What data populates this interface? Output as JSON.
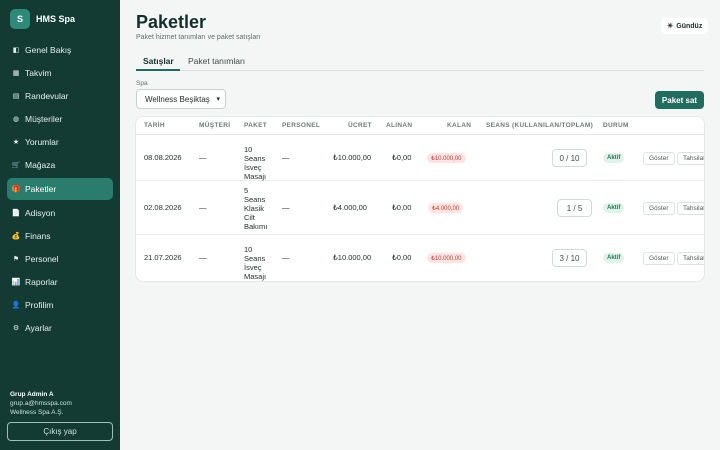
{
  "app": {
    "badge": "S",
    "name": "HMS Spa"
  },
  "nav": [
    {
      "label": "Genel Bakış",
      "icon": "dashboard-icon",
      "glyph": "◧"
    },
    {
      "label": "Takvim",
      "icon": "calendar-icon",
      "glyph": "▦"
    },
    {
      "label": "Randevular",
      "icon": "appointments-icon",
      "glyph": "▤"
    },
    {
      "label": "Müşteriler",
      "icon": "customers-icon",
      "glyph": "◍"
    },
    {
      "label": "Yorumlar",
      "icon": "star-icon",
      "glyph": "★"
    },
    {
      "label": "Mağaza",
      "icon": "cart-icon",
      "glyph": "🛒"
    },
    {
      "label": "Paketler",
      "icon": "gift-icon",
      "glyph": "🎁"
    },
    {
      "label": "Adisyon",
      "icon": "receipt-icon",
      "glyph": "📄"
    },
    {
      "label": "Finans",
      "icon": "money-bag-icon",
      "glyph": "💰"
    },
    {
      "label": "Personel",
      "icon": "staff-icon",
      "glyph": "⚑"
    },
    {
      "label": "Raporlar",
      "icon": "chart-icon",
      "glyph": "📊"
    },
    {
      "label": "Profilim",
      "icon": "profile-icon",
      "glyph": "👤"
    },
    {
      "label": "Ayarlar",
      "icon": "gear-icon",
      "glyph": "⚙"
    }
  ],
  "active_nav": "Paketler",
  "user": {
    "name": "Grup Admin A",
    "email": "grup.a@hmsspa.com",
    "company": "Wellness Spa A.Ş."
  },
  "logout_label": "Çıkış yap",
  "header": {
    "title": "Paketler",
    "subtitle": "Paket hizmet tanımları ve paket satışları",
    "theme_icon": "sun-icon",
    "theme_label": "Gündüz"
  },
  "tabs": [
    {
      "label": "Satışlar"
    },
    {
      "label": "Paket tanımları"
    }
  ],
  "active_tab": "Satışlar",
  "spa": {
    "label": "Spa",
    "selected": "Wellness Beşiktaş"
  },
  "sell_button": "Paket sat",
  "table": {
    "columns": [
      "TARİH",
      "MÜŞTERİ",
      "PAKET",
      "PERSONEL",
      "ÜCRET",
      "ALINAN",
      "KALAN",
      "SEANS (KULLANILAN/TOPLAM)",
      "DURUM"
    ],
    "rows": [
      {
        "date": "08.08.2026",
        "customer": "—",
        "package": "10 Seans İsveç Masajı",
        "staff": "—",
        "price": "₺10.000,00",
        "paid": "₺0,00",
        "remaining": "₺10.000,00",
        "sessions": "0 / 10",
        "status": "Aktif",
        "show": "Göster",
        "collect": "Tahsilat"
      },
      {
        "date": "02.08.2026",
        "customer": "—",
        "package": "5 Seans Klasik Cilt Bakımı",
        "staff": "—",
        "price": "₺4.000,00",
        "paid": "₺0,00",
        "remaining": "₺4.000,00",
        "sessions": "1 / 5",
        "status": "Aktif",
        "show": "Göster",
        "collect": "Tahsilat"
      },
      {
        "date": "21.07.2026",
        "customer": "—",
        "package": "10 Seans İsveç Masajı",
        "staff": "—",
        "price": "₺10.000,00",
        "paid": "₺0,00",
        "remaining": "₺10.000,00",
        "sessions": "3 / 10",
        "status": "Aktif",
        "show": "Göster",
        "collect": "Tahsilat"
      }
    ]
  },
  "colors": {
    "sidebar": "#133b33",
    "accent": "#1f6d5e",
    "danger": "#c0392b",
    "success": "#1d7a55"
  }
}
